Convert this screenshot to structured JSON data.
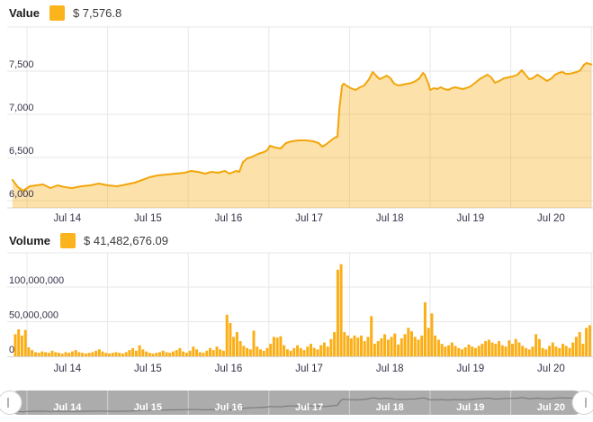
{
  "colors": {
    "gold_line": "#F2A60B",
    "gold_fill_rgb": "#F6A808",
    "gold_fill_opacity": 0.34,
    "gold_bar": "#FBAF17",
    "swatch": "#FCB41D",
    "grid": "#e7e7e7",
    "axis_border": "#d6d6d6",
    "tick_text": "#33334a",
    "nav_bg": "#acacac",
    "nav_separator": "rgba(255,255,255,0.45)",
    "nav_line": "#7d7d7d",
    "nav_text": "#ffffff",
    "handle_fill": "#ffffff",
    "handle_stroke": "#d2d2d2",
    "handle_tick": "#9a9a9a"
  },
  "value_chart": {
    "legend_label": "Value",
    "legend_value": "$ 7,576.8"
  },
  "volume_chart": {
    "legend_label": "Volume",
    "legend_value": "$ 41,482,676.09"
  },
  "navigator": {
    "labels": [
      "Jul 14",
      "Jul 15",
      "Jul 16",
      "Jul 17",
      "Jul 18",
      "Jul 19",
      "Jul 20"
    ]
  },
  "chart_data": [
    {
      "type": "area",
      "title": "Value",
      "current_value_label": "$ 7,576.8",
      "x_axis": {
        "unit": "hours since Jul 14 00:00",
        "labels": [
          "Jul 14",
          "Jul 15",
          "Jul 16",
          "Jul 17",
          "Jul 18",
          "Jul 19",
          "Jul 20"
        ],
        "day_boundaries_hours": [
          0,
          24,
          48,
          72,
          96,
          120,
          144,
          168
        ],
        "range_hours": [
          -4.3,
          168
        ]
      },
      "y_axis": {
        "ticks": [
          6000,
          6500,
          7000,
          7500
        ],
        "tick_labels": [
          "6,000",
          "6,500",
          "7,000",
          "7,500"
        ],
        "range": [
          5920,
          8010
        ],
        "grid": true
      },
      "points": [
        [
          -4.3,
          6240
        ],
        [
          -2.7,
          6156
        ],
        [
          -1.1,
          6115
        ],
        [
          0.8,
          6167
        ],
        [
          2.7,
          6177
        ],
        [
          4.8,
          6188
        ],
        [
          7.0,
          6146
        ],
        [
          9.1,
          6177
        ],
        [
          11.3,
          6156
        ],
        [
          13.4,
          6146
        ],
        [
          16.1,
          6167
        ],
        [
          18.8,
          6177
        ],
        [
          21.4,
          6198
        ],
        [
          24.1,
          6177
        ],
        [
          26.8,
          6167
        ],
        [
          29.5,
          6188
        ],
        [
          32.1,
          6208
        ],
        [
          34.3,
          6240
        ],
        [
          36.4,
          6271
        ],
        [
          38.8,
          6292
        ],
        [
          41.5,
          6302
        ],
        [
          44.2,
          6313
        ],
        [
          46.9,
          6323
        ],
        [
          48.8,
          6344
        ],
        [
          50.9,
          6333
        ],
        [
          53.0,
          6313
        ],
        [
          54.9,
          6333
        ],
        [
          56.8,
          6323
        ],
        [
          58.9,
          6344
        ],
        [
          60.3,
          6313
        ],
        [
          62.2,
          6344
        ],
        [
          63.2,
          6333
        ],
        [
          64.3,
          6448
        ],
        [
          65.6,
          6490
        ],
        [
          67.2,
          6510
        ],
        [
          68.8,
          6542
        ],
        [
          70.5,
          6563
        ],
        [
          71.5,
          6583
        ],
        [
          72.3,
          6635
        ],
        [
          73.9,
          6615
        ],
        [
          75.5,
          6604
        ],
        [
          77.1,
          6667
        ],
        [
          78.8,
          6688
        ],
        [
          80.9,
          6698
        ],
        [
          83.0,
          6698
        ],
        [
          85.2,
          6688
        ],
        [
          86.8,
          6667
        ],
        [
          87.9,
          6625
        ],
        [
          89.2,
          6656
        ],
        [
          90.5,
          6698
        ],
        [
          91.6,
          6729
        ],
        [
          92.4,
          6740
        ],
        [
          93.0,
          7073
        ],
        [
          93.8,
          7333
        ],
        [
          94.3,
          7354
        ],
        [
          95.4,
          7323
        ],
        [
          96.4,
          7302
        ],
        [
          97.8,
          7281
        ],
        [
          99.1,
          7313
        ],
        [
          100.4,
          7333
        ],
        [
          101.8,
          7406
        ],
        [
          102.9,
          7490
        ],
        [
          103.9,
          7448
        ],
        [
          105.0,
          7406
        ],
        [
          106.1,
          7427
        ],
        [
          107.1,
          7448
        ],
        [
          108.2,
          7417
        ],
        [
          109.3,
          7354
        ],
        [
          110.6,
          7333
        ],
        [
          112.0,
          7344
        ],
        [
          113.3,
          7354
        ],
        [
          114.6,
          7365
        ],
        [
          115.7,
          7385
        ],
        [
          116.8,
          7417
        ],
        [
          117.9,
          7479
        ],
        [
          118.4,
          7458
        ],
        [
          119.5,
          7354
        ],
        [
          120.0,
          7281
        ],
        [
          121.1,
          7302
        ],
        [
          122.1,
          7292
        ],
        [
          123.2,
          7313
        ],
        [
          124.3,
          7292
        ],
        [
          125.4,
          7281
        ],
        [
          126.4,
          7302
        ],
        [
          127.5,
          7313
        ],
        [
          128.6,
          7302
        ],
        [
          129.6,
          7292
        ],
        [
          130.7,
          7302
        ],
        [
          132.0,
          7323
        ],
        [
          133.4,
          7365
        ],
        [
          134.7,
          7406
        ],
        [
          136.1,
          7438
        ],
        [
          137.1,
          7458
        ],
        [
          138.2,
          7427
        ],
        [
          139.3,
          7365
        ],
        [
          140.6,
          7385
        ],
        [
          142.0,
          7417
        ],
        [
          143.3,
          7427
        ],
        [
          144.6,
          7438
        ],
        [
          146.0,
          7458
        ],
        [
          147.3,
          7510
        ],
        [
          148.4,
          7458
        ],
        [
          149.5,
          7406
        ],
        [
          150.5,
          7417
        ],
        [
          151.9,
          7458
        ],
        [
          153.2,
          7427
        ],
        [
          154.8,
          7385
        ],
        [
          156.2,
          7417
        ],
        [
          157.2,
          7458
        ],
        [
          158.3,
          7479
        ],
        [
          159.4,
          7490
        ],
        [
          160.4,
          7469
        ],
        [
          161.5,
          7469
        ],
        [
          162.6,
          7479
        ],
        [
          163.7,
          7490
        ],
        [
          164.7,
          7510
        ],
        [
          165.8,
          7573
        ],
        [
          166.6,
          7594
        ],
        [
          167.4,
          7583
        ],
        [
          168.0,
          7576.8
        ]
      ]
    },
    {
      "type": "bar",
      "title": "Volume",
      "current_value_label": "$ 41,482,676.09",
      "x_axis": {
        "unit": "hourly bars, hours since Jul 14 00:00",
        "labels": [
          "Jul 14",
          "Jul 15",
          "Jul 16",
          "Jul 17",
          "Jul 18",
          "Jul 19",
          "Jul 20"
        ],
        "day_boundaries_hours": [
          0,
          24,
          48,
          72,
          96,
          120,
          144,
          168
        ],
        "bar_start_hour": -4,
        "bar_width_hours": 1
      },
      "y_axis": {
        "ticks": [
          0,
          50000000,
          100000000
        ],
        "tick_labels": [
          "0",
          "50,000,000",
          "100,000,000"
        ],
        "range": [
          0,
          145000000
        ],
        "grid": true
      },
      "values_millions": [
        32,
        39,
        30,
        38,
        13,
        9,
        6,
        5,
        7,
        6,
        5,
        8,
        6,
        5,
        4,
        6,
        5,
        7,
        9,
        6,
        5,
        4,
        5,
        6,
        8,
        10,
        7,
        5,
        4,
        5,
        6,
        5,
        4,
        6,
        9,
        12,
        8,
        16,
        10,
        7,
        5,
        4,
        5,
        6,
        8,
        6,
        5,
        7,
        9,
        12,
        7,
        5,
        8,
        14,
        10,
        6,
        5,
        8,
        12,
        9,
        14,
        10,
        8,
        60,
        48,
        28,
        35,
        22,
        15,
        12,
        10,
        37,
        14,
        10,
        8,
        12,
        18,
        28,
        27,
        29,
        16,
        10,
        8,
        12,
        16,
        12,
        9,
        14,
        18,
        12,
        10,
        16,
        20,
        14,
        25,
        35,
        125,
        133,
        35,
        30,
        26,
        30,
        27,
        30,
        22,
        28,
        58,
        18,
        22,
        26,
        32,
        24,
        28,
        33,
        17,
        26,
        32,
        41,
        36,
        28,
        24,
        30,
        78,
        41,
        62,
        30,
        24,
        18,
        14,
        16,
        20,
        15,
        12,
        10,
        13,
        17,
        14,
        12,
        15,
        18,
        22,
        24,
        20,
        18,
        22,
        16,
        14,
        23,
        18,
        25,
        20,
        15,
        12,
        10,
        14,
        32,
        25,
        12,
        10,
        15,
        20,
        14,
        12,
        18,
        15,
        12,
        20,
        28,
        35,
        18,
        41,
        45
      ]
    }
  ]
}
